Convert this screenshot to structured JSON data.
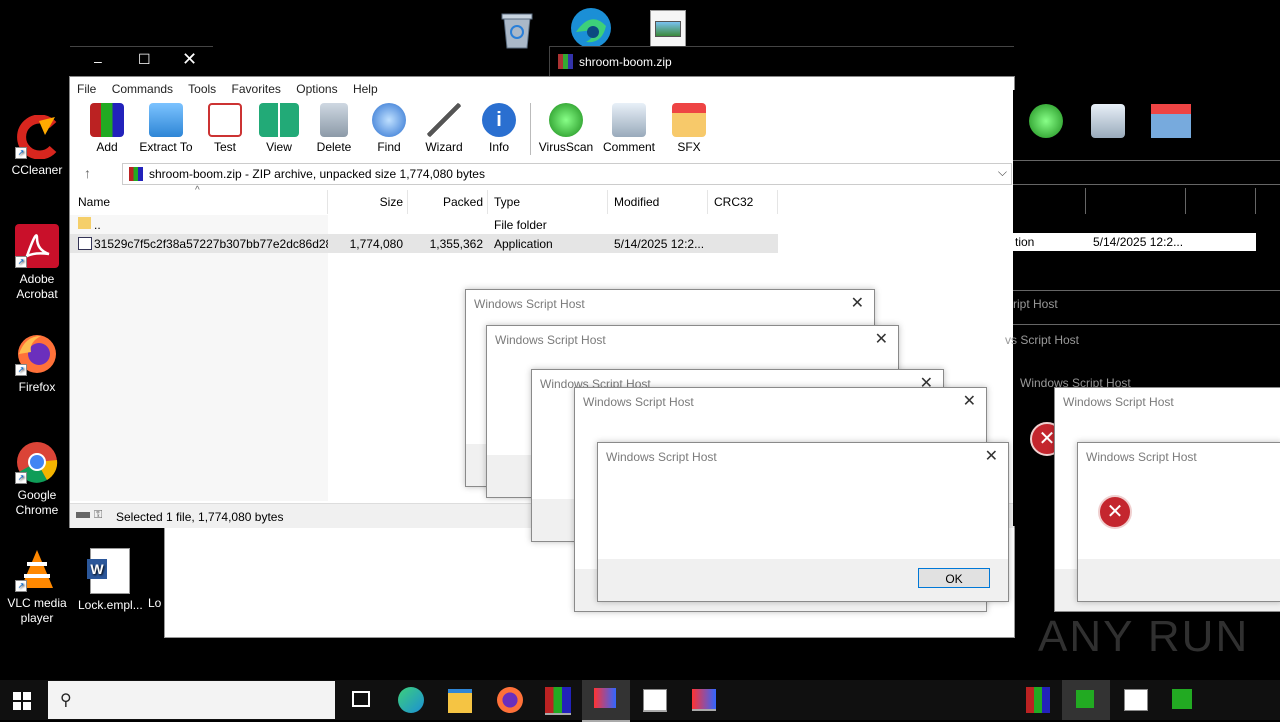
{
  "desktop": {
    "icons": [
      {
        "label": "CCleaner"
      },
      {
        "label": "Adobe Acrobat"
      },
      {
        "label": "Firefox"
      },
      {
        "label": "Google Chrome"
      },
      {
        "label": "VLC media player"
      },
      {
        "label": "Lock.empl..."
      },
      {
        "label": "Lo"
      }
    ]
  },
  "winrar": {
    "tab_title": "shroom-boom.zip",
    "menu": [
      "File",
      "Commands",
      "Tools",
      "Favorites",
      "Options",
      "Help"
    ],
    "toolbar": [
      "Add",
      "Extract To",
      "Test",
      "View",
      "Delete",
      "Find",
      "Wizard",
      "Info",
      "VirusScan",
      "Comment",
      "SFX"
    ],
    "path": "shroom-boom.zip - ZIP archive, unpacked size 1,774,080 bytes",
    "columns": [
      "Name",
      "Size",
      "Packed",
      "Type",
      "Modified",
      "CRC32"
    ],
    "rows": [
      {
        "name": "..",
        "size": "",
        "packed": "",
        "type": "File folder",
        "modified": "",
        "crc": ""
      },
      {
        "name": "31529c7f5c2f38a57227b307bb77e2dc86d28...",
        "size": "1,774,080",
        "packed": "1,355,362",
        "type": "Application",
        "modified": "5/14/2025 12:2...",
        "crc": ""
      }
    ],
    "status": "Selected 1 file, 1,774,080 bytes"
  },
  "back_window": {
    "row_type": "tion",
    "row_modified": "5/14/2025 12:2..."
  },
  "dialogs": {
    "title": "Windows Script Host",
    "partial1": "ript Host",
    "partial2": "vs Script Host",
    "ok": "OK"
  },
  "watermark": "ANY RUN"
}
